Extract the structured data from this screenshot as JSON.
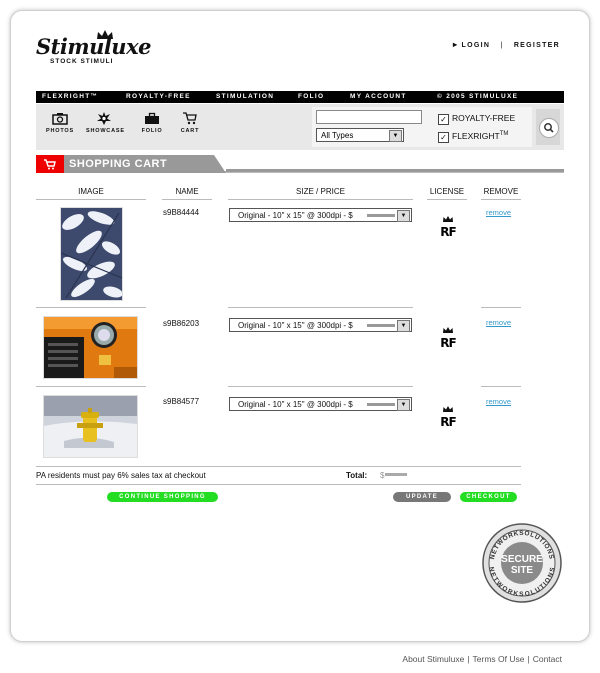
{
  "brand": {
    "name": "Stimuluxe",
    "tagline": "STOCK STIMULI"
  },
  "top_links": {
    "login": "LOGIN",
    "separator": "|",
    "register": "REGISTER"
  },
  "nav": [
    "FLEXRIGHT™",
    "ROYALTY-FREE",
    "STIMULATION",
    "FOLIO",
    "MY ACCOUNT",
    "© 2005 STIMULUXE"
  ],
  "tools": [
    {
      "label": "PHOTOS",
      "icon": "camera-icon"
    },
    {
      "label": "SHOWCASE",
      "icon": "starburst-icon"
    },
    {
      "label": "FOLIO",
      "icon": "briefcase-icon"
    },
    {
      "label": "CART",
      "icon": "cart-icon"
    }
  ],
  "search": {
    "value": "",
    "type_selected": "All Types",
    "royalty_free_label": "ROYALTY-FREE",
    "royalty_free_checked": true,
    "flexright_label": "FLEXRIGHT",
    "flexright_sup": "TM",
    "flexright_checked": true,
    "button_icon": "search-icon"
  },
  "cart": {
    "title": "SHOPPING CART",
    "columns": {
      "image": "IMAGE",
      "name": "NAME",
      "size_price": "SIZE / PRICE",
      "license": "LICENSE",
      "remove": "REMOVE"
    },
    "items": [
      {
        "sku": "s9B84444",
        "size": "Original - 10\" x 15\" @ 300dpi - $",
        "license": "RF",
        "remove": "remove",
        "image": "snow-covered pine branches"
      },
      {
        "sku": "s9B86203",
        "size": "Original - 10\" x 15\" @ 300dpi - $",
        "license": "RF",
        "remove": "remove",
        "image": "orange car headlight"
      },
      {
        "sku": "s9B84577",
        "size": "Original - 10\" x 15\" @ 300dpi - $",
        "license": "RF",
        "remove": "remove",
        "image": "yellow fire hydrant in snow"
      }
    ],
    "tax_note": "PA residents must pay 6% sales tax at checkout",
    "total_label": "Total:",
    "total_value": "$",
    "buttons": {
      "continue": "CONTINUE SHOPPING",
      "update": "UPDATE",
      "checkout": "CHECKOUT"
    }
  },
  "seal": {
    "top": "NETWORKSOLUTIONS",
    "line1": "SECURE",
    "line2": "SITE",
    "bottom": "NETWORKSOLUTIONS"
  },
  "footer": {
    "about": "About Stimuluxe",
    "terms": "Terms Of Use",
    "contact": "Contact",
    "separator": "|"
  },
  "colors": {
    "accent_red": "#e00000",
    "button_green": "#22dd22",
    "button_gray": "#777777",
    "link_blue": "#3399cc"
  }
}
